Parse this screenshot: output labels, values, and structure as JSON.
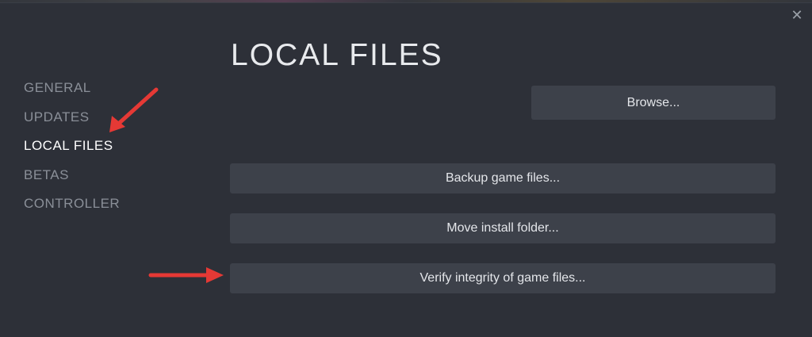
{
  "dialog": {
    "title": "LOCAL FILES",
    "close_glyph": "✕"
  },
  "sidebar": {
    "items": [
      {
        "label": "GENERAL",
        "active": false
      },
      {
        "label": "UPDATES",
        "active": false
      },
      {
        "label": "LOCAL FILES",
        "active": true
      },
      {
        "label": "BETAS",
        "active": false
      },
      {
        "label": "CONTROLLER",
        "active": false
      }
    ]
  },
  "buttons": {
    "browse": "Browse...",
    "backup": "Backup game files...",
    "move": "Move install folder...",
    "verify": "Verify integrity of game files..."
  },
  "annotations": {
    "arrow_color": "#e53935"
  },
  "colors": {
    "background": "#2d3038",
    "button": "#3d414a",
    "active_text": "#ffffff",
    "inactive_text": "#8a8f98"
  }
}
